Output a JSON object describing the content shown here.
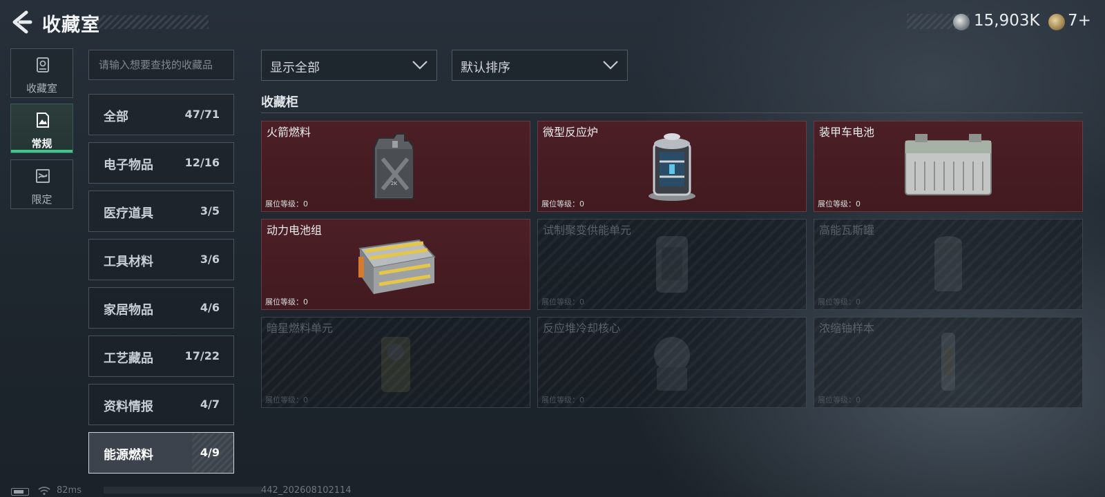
{
  "header": {
    "title": "收藏室",
    "currency": [
      {
        "icon": "silver-coin-icon",
        "value": "15,903K"
      },
      {
        "icon": "gold-ticket-icon",
        "value": "7+"
      }
    ]
  },
  "side_tabs": [
    {
      "label": "收藏室",
      "icon": "collection-room-icon",
      "active": false
    },
    {
      "label": "常规",
      "icon": "regular-icon",
      "active": true
    },
    {
      "label": "限定",
      "icon": "limited-icon",
      "active": false
    }
  ],
  "search": {
    "placeholder": "请输入想要查找的收藏品",
    "value": ""
  },
  "categories": [
    {
      "name": "全部",
      "count": "47/71"
    },
    {
      "name": "电子物品",
      "count": "12/16"
    },
    {
      "name": "医疗道具",
      "count": "3/5"
    },
    {
      "name": "工具材料",
      "count": "3/6"
    },
    {
      "name": "家居物品",
      "count": "4/6"
    },
    {
      "name": "工艺藏品",
      "count": "17/22"
    },
    {
      "name": "资料情报",
      "count": "4/7"
    },
    {
      "name": "能源燃料",
      "count": "4/9",
      "active": true
    }
  ],
  "filters": {
    "filter_value": "显示全部",
    "sort_value": "默认排序"
  },
  "section_title": "收藏柜",
  "items": [
    {
      "name": "火箭燃料",
      "level": "展位等级：0",
      "owned": true,
      "icon": "fuel-jerrycan-icon"
    },
    {
      "name": "微型反应炉",
      "level": "展位等级：0",
      "owned": true,
      "icon": "micro-reactor-icon"
    },
    {
      "name": "装甲车电池",
      "level": "展位等级：0",
      "owned": true,
      "icon": "vehicle-battery-icon"
    },
    {
      "name": "动力电池组",
      "level": "展位等级：0",
      "owned": true,
      "icon": "battery-pack-icon"
    },
    {
      "name": "试制聚变供能单元",
      "level": "展位等级：0",
      "owned": false,
      "icon": "fusion-unit-icon"
    },
    {
      "name": "高能瓦斯罐",
      "level": "展位等级：0",
      "owned": false,
      "icon": "gas-tank-icon"
    },
    {
      "name": "暗星燃料单元",
      "level": "展位等级：0",
      "owned": false,
      "icon": "darkstar-fuel-icon"
    },
    {
      "name": "反应堆冷却核心",
      "level": "展位等级：0",
      "owned": false,
      "icon": "reactor-core-icon"
    },
    {
      "name": "浓缩铀样本",
      "level": "展位等级：0",
      "owned": false,
      "icon": "uranium-sample-icon"
    }
  ],
  "status": {
    "ping": "82ms",
    "build": "442_202608102114"
  },
  "colors": {
    "accent_green": "#3fc58d",
    "owned_card_bg": "#4b1f25",
    "locked_card_bg": "#1b2227"
  }
}
